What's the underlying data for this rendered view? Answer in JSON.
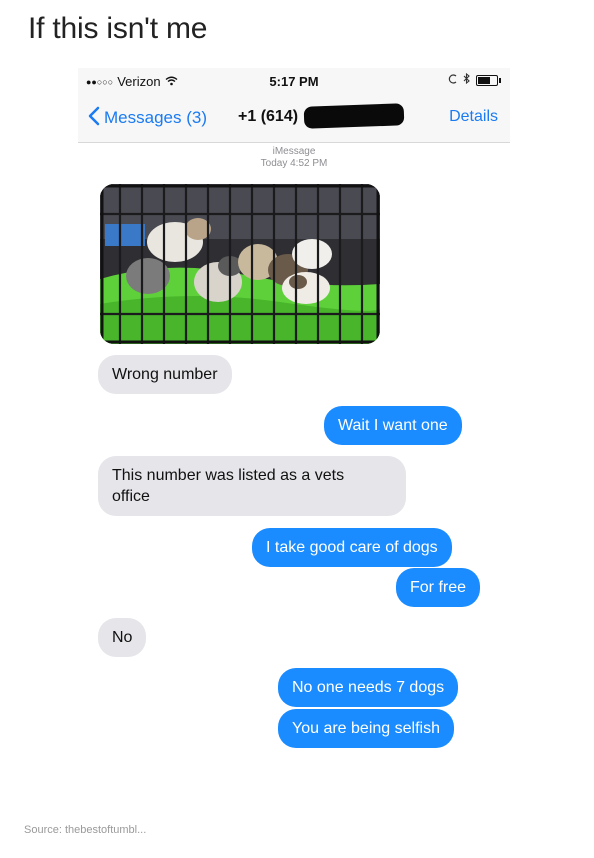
{
  "post": {
    "title": "If this isn't me",
    "source": "Source: thebestoftumbl..."
  },
  "status_bar": {
    "signal": "●●○○○",
    "carrier": "Verizon",
    "time": "5:17 PM"
  },
  "nav": {
    "back_label": "Messages (3)",
    "contact": "+1 (614)",
    "details_label": "Details"
  },
  "thread": {
    "service": "iMessage",
    "timestamp": "Today 4:52 PM"
  },
  "messages": [
    {
      "dir": "in",
      "text": "Wrong number"
    },
    {
      "dir": "out",
      "text": "Wait I want one"
    },
    {
      "dir": "in",
      "text": "This number was listed as a vets"
    },
    {
      "dir": "in",
      "text": "office"
    },
    {
      "dir": "out",
      "text": "I take good care of dogs"
    },
    {
      "dir": "out",
      "text": "For free"
    },
    {
      "dir": "in",
      "text": "No"
    },
    {
      "dir": "out",
      "text": "No one needs 7 dogs"
    },
    {
      "dir": "out",
      "text": "You are being selfish"
    }
  ],
  "colors": {
    "incoming_bubble": "#e5e5ea",
    "outgoing_bubble": "#1a8cff",
    "ios_blue": "#1a7bf2"
  },
  "icons": {
    "wifi": "wifi-icon",
    "battery": "battery-icon",
    "bluetooth": "bluetooth-icon",
    "back": "chevron-left-icon"
  }
}
